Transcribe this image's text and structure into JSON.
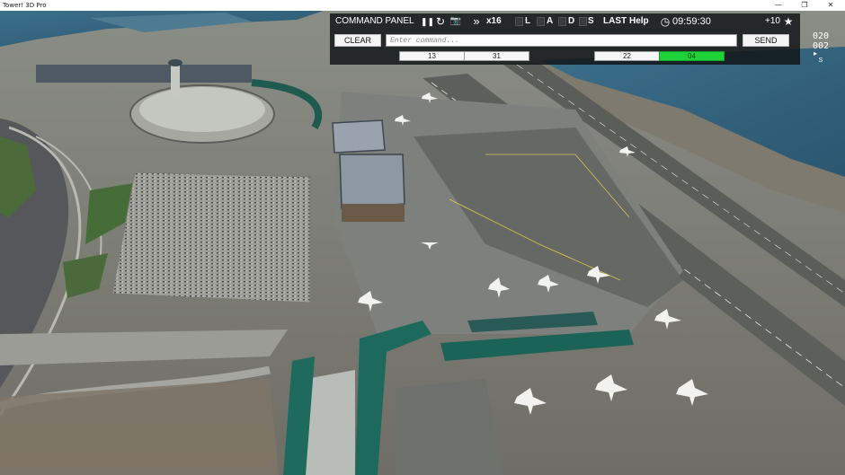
{
  "window": {
    "title": "Tower! 3D Pro",
    "minimize_glyph": "—",
    "restore_glyph": "❐",
    "close_glyph": "✕"
  },
  "panel": {
    "title": "COMMAND PANEL",
    "pause_icon": "pause-icon",
    "pause_glyph": "❚❚",
    "refresh_icon": "refresh-icon",
    "refresh_glyph": "↻",
    "camera_icon": "camera-icon",
    "camera_glyph": "📷",
    "fast_forward_glyph": "»",
    "speed": "x16",
    "toggles": [
      "L",
      "A",
      "D",
      "S"
    ],
    "last_label": "LAST",
    "help_label": "Help",
    "clock_icon": "clock-icon",
    "clock_glyph": "◷",
    "clock": "09:59:30",
    "score": "+10",
    "star_icon": "star-icon",
    "star_glyph": "★",
    "clear_label": "CLEAR",
    "command_placeholder": "Enter command...",
    "send_label": "SEND",
    "runways_left": [
      "13",
      "31"
    ],
    "runways_right": [
      "22",
      "04"
    ],
    "active_runway": "04",
    "active_color": "#1fd23a"
  },
  "compass": {
    "top": "020",
    "bottom": "002",
    "south": "S",
    "arrow_glyph": "▸"
  }
}
